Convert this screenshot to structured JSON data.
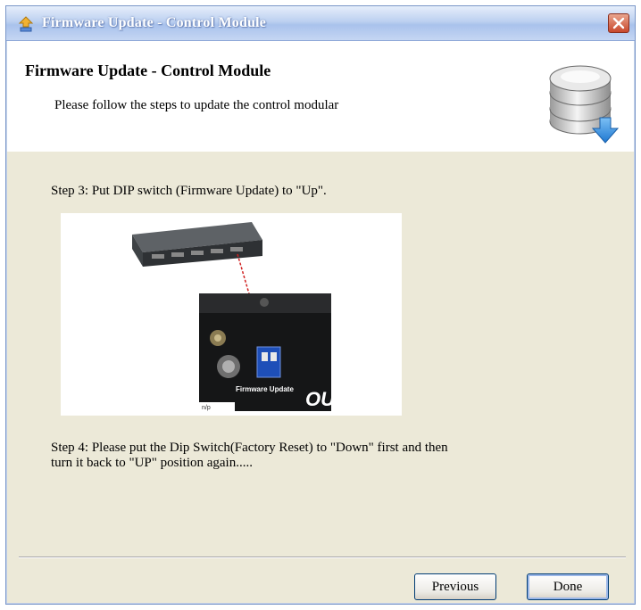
{
  "window": {
    "title": "Firmware Update - Control Module",
    "icons": {
      "app": "firmware-update-icon",
      "close": "close-icon"
    }
  },
  "header": {
    "title": "Firmware Update - Control Module",
    "subtitle": "Please follow the steps to update the control modular",
    "icon": "database-download-icon"
  },
  "steps": {
    "step3": "Step 3: Put DIP switch (Firmware Update) to \"Up\".",
    "step4_line1": "Step 4: Please put the Dip Switch(Factory Reset) to \"Down\" first and then",
    "step4_line2": "turn it back to \"UP\" position again....."
  },
  "photo": {
    "label": "Firmware Update",
    "logo_text": "OU",
    "corner_text": "n/p"
  },
  "buttons": {
    "previous": "Previous",
    "done": "Done"
  },
  "colors": {
    "dialog_bg": "#ece9d8",
    "titlebar": "#a9c2ec",
    "close": "#c8482d",
    "button_border": "#003c74"
  }
}
